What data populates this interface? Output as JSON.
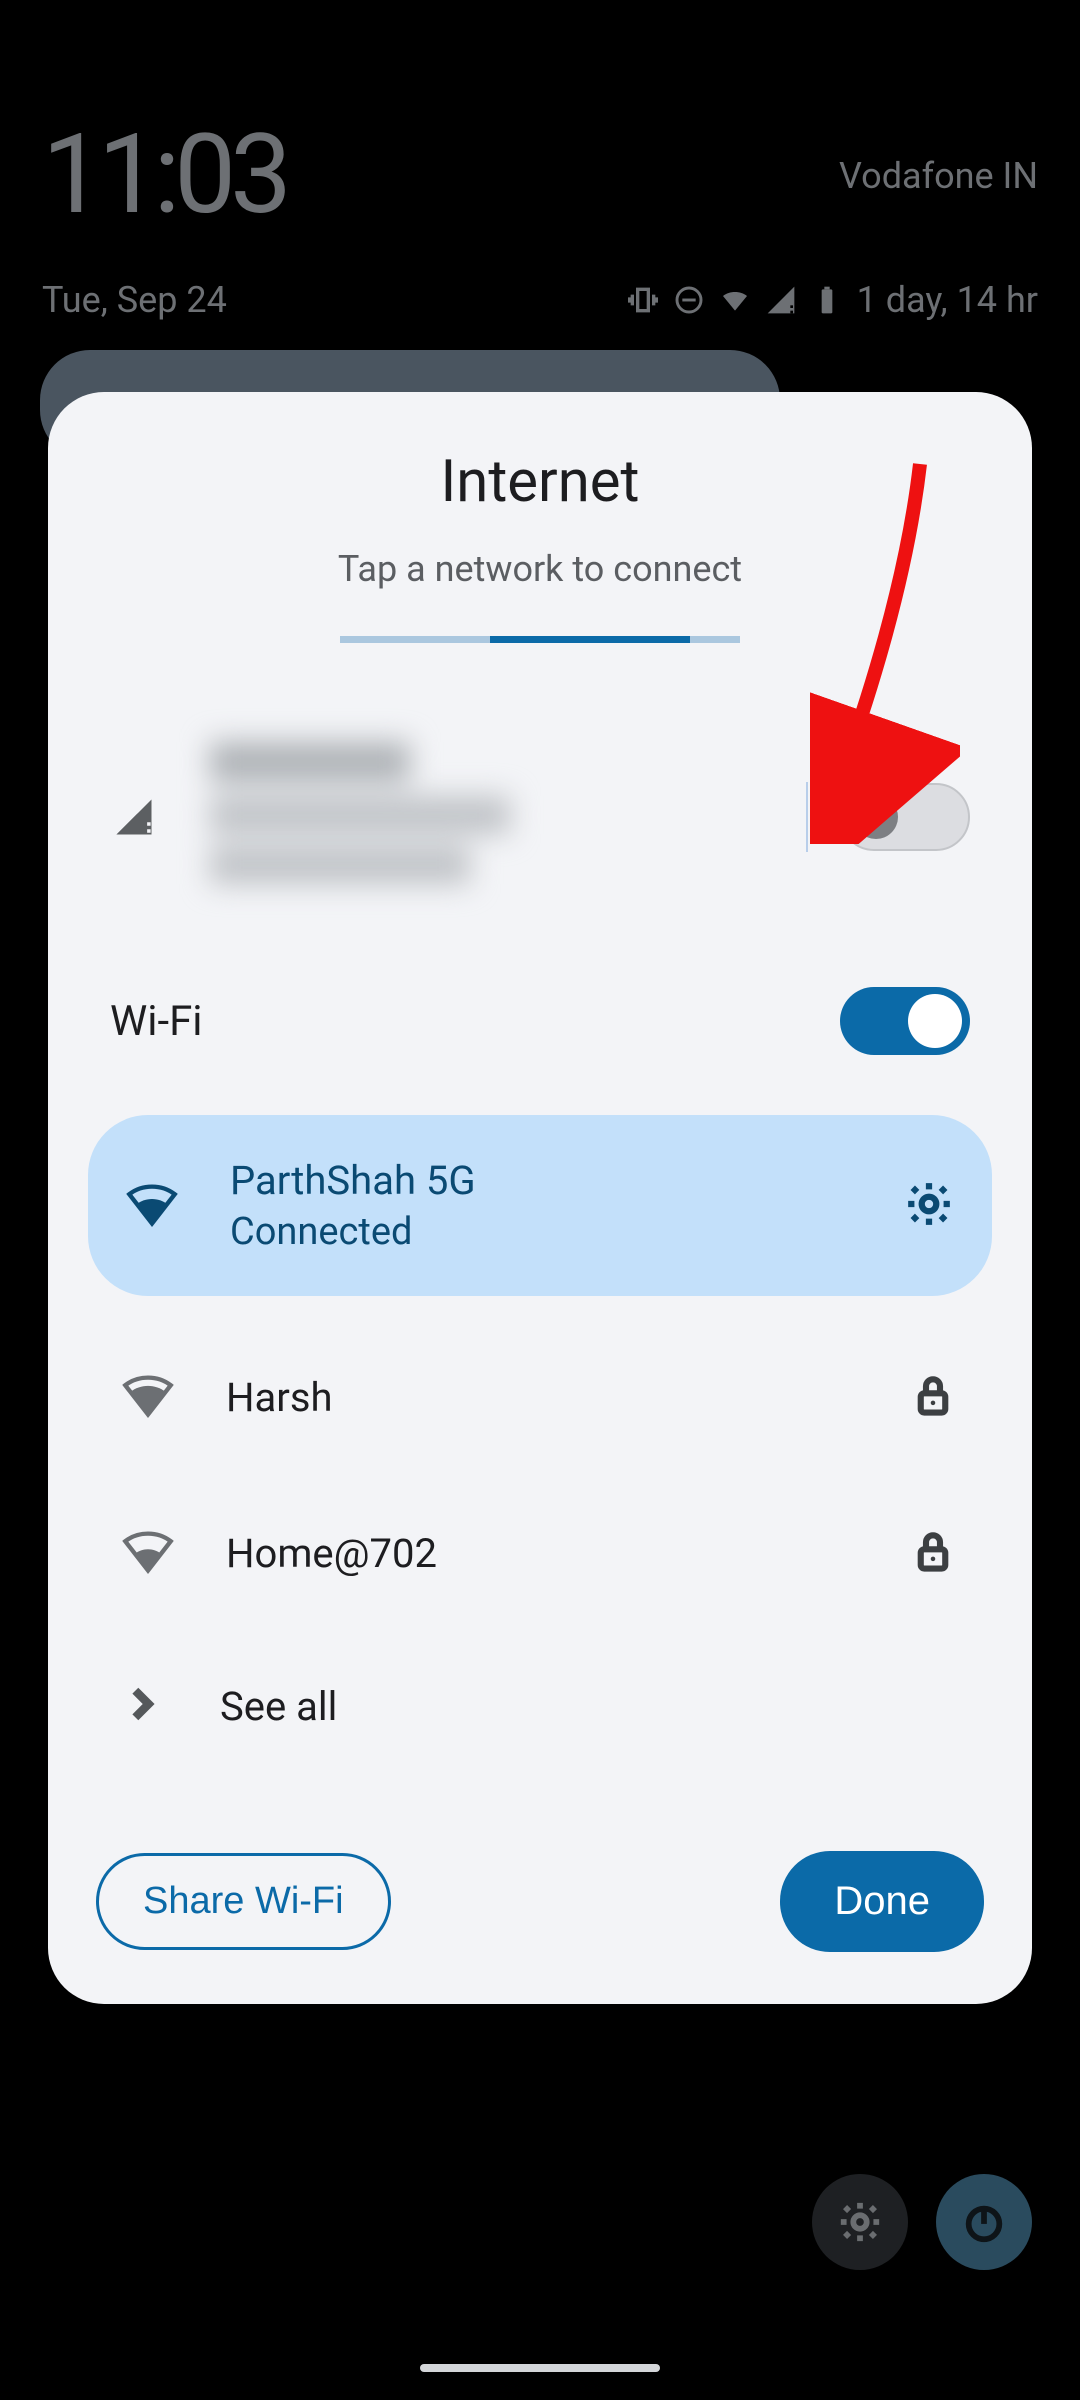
{
  "statusbar": {
    "clock": "11:03",
    "carrier": "Vodafone IN",
    "date": "Tue, Sep 24",
    "battery_text": "1 day, 14 hr"
  },
  "sheet": {
    "title": "Internet",
    "subtitle": "Tap a network to connect"
  },
  "mobile_data": {
    "carrier_name": "",
    "toggle_on": false
  },
  "wifi": {
    "label": "Wi-Fi",
    "toggle_on": true,
    "connected": {
      "name": "ParthShah 5G",
      "status": "Connected"
    },
    "networks": [
      {
        "name": "Harsh",
        "secured": true
      },
      {
        "name": "Home@702",
        "secured": true
      }
    ],
    "see_all_label": "See all"
  },
  "buttons": {
    "share": "Share Wi-Fi",
    "done": "Done"
  }
}
